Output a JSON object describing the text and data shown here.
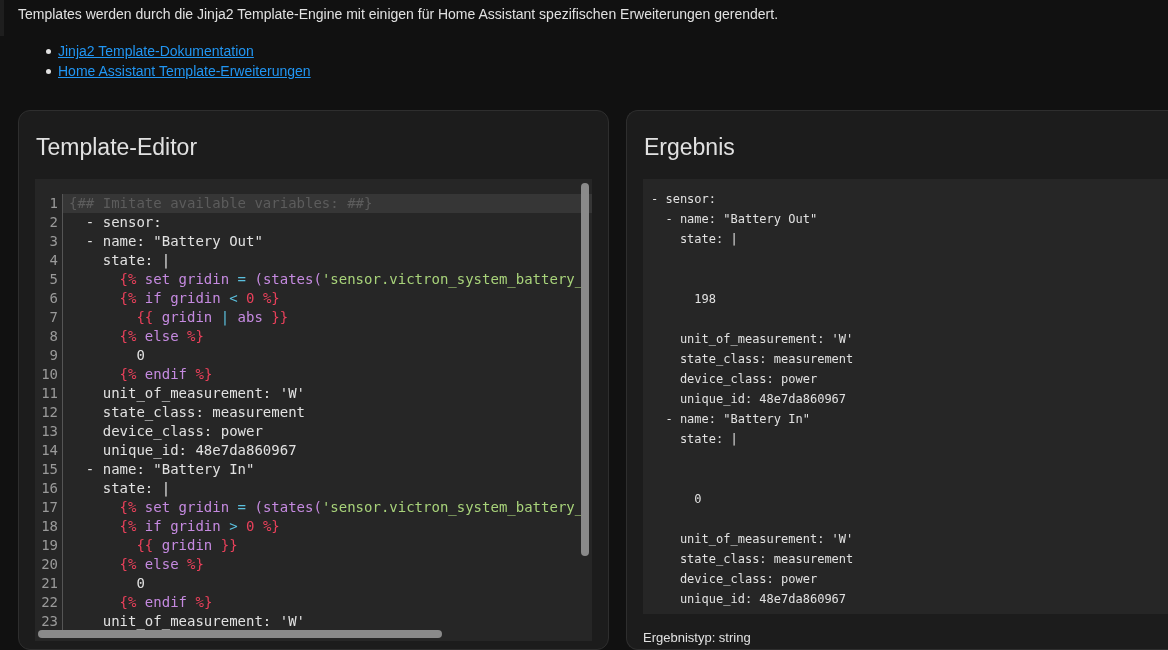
{
  "intro": "Templates werden durch die Jinja2 Template-Engine mit einigen für Home Assistant spezifischen Erweiterungen gerendert.",
  "links": [
    "Jinja2 Template-Dokumentation",
    "Home Assistant Template-Erweiterungen"
  ],
  "editor": {
    "title": "Template-Editor",
    "lines": [
      {
        "number": "1",
        "active": true,
        "tokens": [
          {
            "kind": "comment",
            "text": "{## Imitate available variables: ##}"
          }
        ]
      },
      {
        "number": "2",
        "active": false,
        "tokens": [
          {
            "kind": "text",
            "text": "  - sensor:"
          }
        ]
      },
      {
        "number": "3",
        "active": false,
        "tokens": [
          {
            "kind": "text",
            "text": "  - name: \"Battery Out\""
          }
        ]
      },
      {
        "number": "4",
        "active": false,
        "tokens": [
          {
            "kind": "text",
            "text": "    state: |"
          }
        ]
      },
      {
        "number": "5",
        "active": false,
        "tokens": [
          {
            "kind": "delim",
            "text": "      {%"
          },
          {
            "kind": "keyword",
            "text": " set gridin "
          },
          {
            "kind": "op",
            "text": "="
          },
          {
            "kind": "keyword",
            "text": " (states("
          },
          {
            "kind": "string",
            "text": "'sensor.victron_system_battery_"
          }
        ]
      },
      {
        "number": "6",
        "active": false,
        "tokens": [
          {
            "kind": "delim",
            "text": "      {%"
          },
          {
            "kind": "keyword",
            "text": " if gridin "
          },
          {
            "kind": "op",
            "text": "<"
          },
          {
            "kind": "delim",
            "text": " 0 %}"
          }
        ]
      },
      {
        "number": "7",
        "active": false,
        "tokens": [
          {
            "kind": "delim",
            "text": "        {{"
          },
          {
            "kind": "keyword",
            "text": " gridin "
          },
          {
            "kind": "op",
            "text": "|"
          },
          {
            "kind": "keyword",
            "text": " abs "
          },
          {
            "kind": "delim",
            "text": "}}"
          }
        ]
      },
      {
        "number": "8",
        "active": false,
        "tokens": [
          {
            "kind": "delim",
            "text": "      {%"
          },
          {
            "kind": "keyword",
            "text": " else "
          },
          {
            "kind": "delim",
            "text": "%}"
          }
        ]
      },
      {
        "number": "9",
        "active": false,
        "tokens": [
          {
            "kind": "text",
            "text": "        0"
          }
        ]
      },
      {
        "number": "10",
        "active": false,
        "tokens": [
          {
            "kind": "delim",
            "text": "      {%"
          },
          {
            "kind": "keyword",
            "text": " endif "
          },
          {
            "kind": "delim",
            "text": "%}"
          }
        ]
      },
      {
        "number": "11",
        "active": false,
        "tokens": [
          {
            "kind": "text",
            "text": "    unit_of_measurement: 'W'"
          }
        ]
      },
      {
        "number": "12",
        "active": false,
        "tokens": [
          {
            "kind": "text",
            "text": "    state_class: measurement"
          }
        ]
      },
      {
        "number": "13",
        "active": false,
        "tokens": [
          {
            "kind": "text",
            "text": "    device_class: power"
          }
        ]
      },
      {
        "number": "14",
        "active": false,
        "tokens": [
          {
            "kind": "text",
            "text": "    unique_id: 48e7da860967"
          }
        ]
      },
      {
        "number": "15",
        "active": false,
        "tokens": [
          {
            "kind": "text",
            "text": "  - name: \"Battery In\""
          }
        ]
      },
      {
        "number": "16",
        "active": false,
        "tokens": [
          {
            "kind": "text",
            "text": "    state: |"
          }
        ]
      },
      {
        "number": "17",
        "active": false,
        "tokens": [
          {
            "kind": "delim",
            "text": "      {%"
          },
          {
            "kind": "keyword",
            "text": " set gridin "
          },
          {
            "kind": "op",
            "text": "="
          },
          {
            "kind": "keyword",
            "text": " (states("
          },
          {
            "kind": "string",
            "text": "'sensor.victron_system_battery_"
          }
        ]
      },
      {
        "number": "18",
        "active": false,
        "tokens": [
          {
            "kind": "delim",
            "text": "      {%"
          },
          {
            "kind": "keyword",
            "text": " if gridin "
          },
          {
            "kind": "op",
            "text": ">"
          },
          {
            "kind": "delim",
            "text": " 0 %}"
          }
        ]
      },
      {
        "number": "19",
        "active": false,
        "tokens": [
          {
            "kind": "delim",
            "text": "        {{"
          },
          {
            "kind": "keyword",
            "text": " gridin "
          },
          {
            "kind": "delim",
            "text": "}}"
          }
        ]
      },
      {
        "number": "20",
        "active": false,
        "tokens": [
          {
            "kind": "delim",
            "text": "      {%"
          },
          {
            "kind": "keyword",
            "text": " else "
          },
          {
            "kind": "delim",
            "text": "%}"
          }
        ]
      },
      {
        "number": "21",
        "active": false,
        "tokens": [
          {
            "kind": "text",
            "text": "        0"
          }
        ]
      },
      {
        "number": "22",
        "active": false,
        "tokens": [
          {
            "kind": "delim",
            "text": "      {%"
          },
          {
            "kind": "keyword",
            "text": " endif "
          },
          {
            "kind": "delim",
            "text": "%}"
          }
        ]
      },
      {
        "number": "23",
        "active": false,
        "tokens": [
          {
            "kind": "text",
            "text": "    unit_of_measurement: 'W'"
          }
        ]
      }
    ]
  },
  "result": {
    "title": "Ergebnis",
    "output": "- sensor:\n  - name: \"Battery Out\"\n    state: |\n\n\n      198\n\n    unit_of_measurement: 'W'\n    state_class: measurement\n    device_class: power\n    unique_id: 48e7da860967\n  - name: \"Battery In\"\n    state: |\n\n\n      0\n\n    unit_of_measurement: 'W'\n    state_class: measurement\n    device_class: power\n    unique_id: 48e7da860967",
    "type": "Ergebnistyp: string"
  }
}
